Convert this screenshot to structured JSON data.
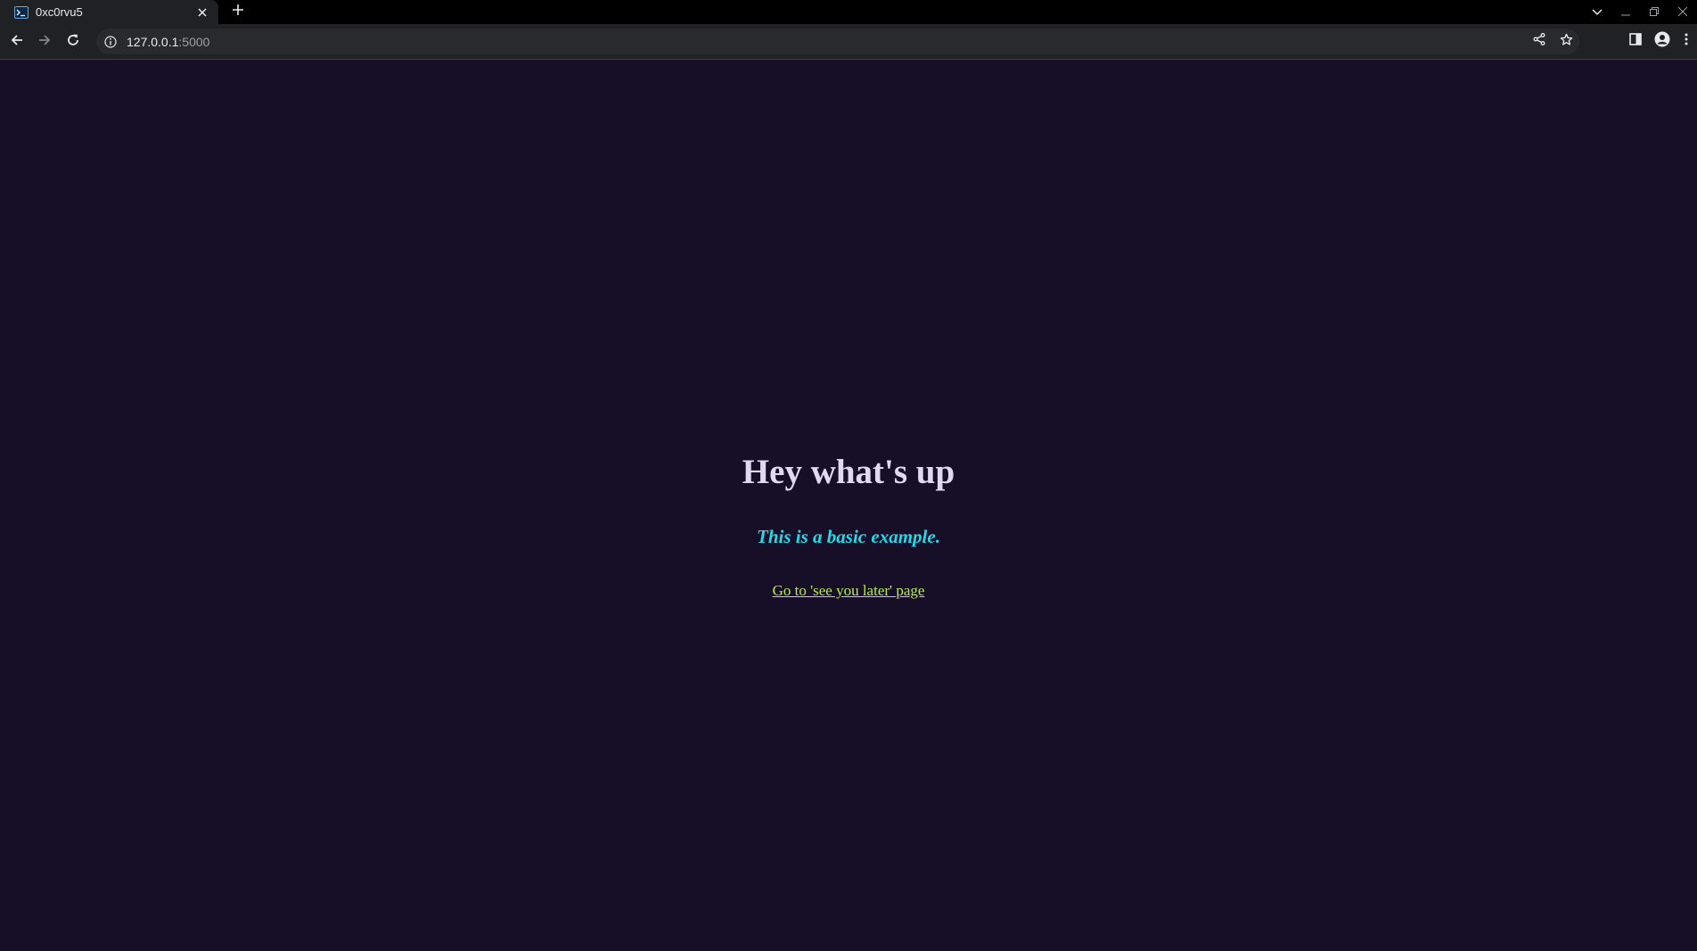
{
  "browser": {
    "tab": {
      "title": "0xc0rvu5",
      "favicon": "terminal-icon"
    },
    "address_bar": {
      "host": "127.0.0.1",
      "port": ":5000"
    },
    "icons": {
      "back": "back-arrow-icon",
      "forward": "forward-arrow-icon",
      "reload": "reload-icon",
      "info": "info-icon",
      "share": "share-icon",
      "bookmark": "star-icon",
      "side_panel": "side-panel-icon",
      "profile": "profile-icon",
      "menu": "kebab-menu-icon",
      "tab_search": "chevron-down-icon",
      "minimize": "minimize-icon",
      "restore": "restore-icon",
      "close": "close-icon"
    }
  },
  "page": {
    "heading": "Hey what's up",
    "subtitle": "This is a basic example.",
    "link_text": "Go to 'see you later' page",
    "colors": {
      "background": "#170f27",
      "heading": "#e0d9f4",
      "subtitle": "#20dbe9",
      "link": "#b7f03c"
    }
  }
}
